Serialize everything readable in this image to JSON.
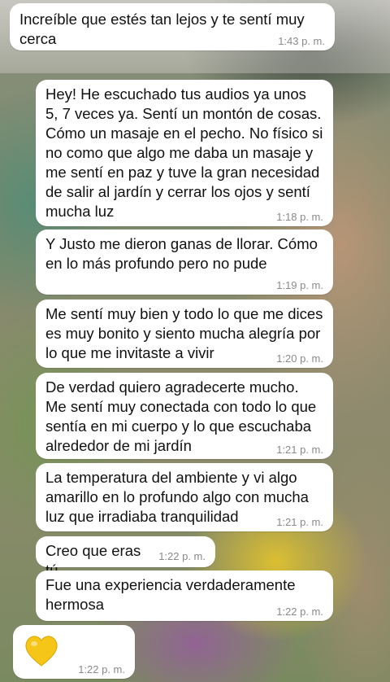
{
  "chat": {
    "messages": [
      {
        "text": "Increíble que estés tan lejos y te sentí muy\ncerca",
        "time": "1:43 p. m."
      },
      {
        "text": "Hey! He escuchado tus audios ya unos\n5, 7 veces ya. Sentí un montón de cosas.\nCómo un masaje en el pecho. No físico si\nno como que algo me daba un masaje y\nme sentí en paz y tuve la gran necesidad\nde salir al jardín y cerrar los ojos y sentí\nmucha luz",
        "time": "1:18 p. m."
      },
      {
        "text": "Y Justo me dieron ganas de llorar. Cómo\nen lo más profundo pero no pude",
        "time": "1:19 p. m."
      },
      {
        "text": "Me sentí muy bien y todo lo que me dices\nes muy bonito y siento mucha alegría por\nlo que me invitaste a vivir",
        "time": "1:20 p. m."
      },
      {
        "text": "De verdad quiero agradecerte mucho.\nMe sentí muy conectada con todo lo que\nsentía en mi cuerpo y lo que escuchaba\nalrededor de mi jardín",
        "time": "1:21 p. m."
      },
      {
        "text": "La temperatura del ambiente y vi algo\namarillo en lo profundo algo con mucha\nluz que irradiaba tranquilidad",
        "time": "1:21 p. m."
      },
      {
        "text": "Creo que eras tú",
        "time": "1:22 p. m."
      },
      {
        "text": "Fue una experiencia verdaderamente\nhermosa",
        "time": "1:22 p. m."
      },
      {
        "text": "",
        "emoji": "yellow-heart",
        "time": "1:22 p. m."
      }
    ]
  },
  "colors": {
    "bubble": "#ffffff",
    "timestamp": "#8a8a8a",
    "heart": "#f5c518"
  }
}
